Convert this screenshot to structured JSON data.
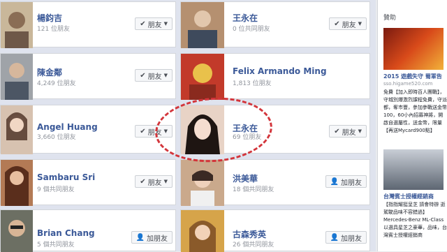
{
  "friends": [
    {
      "name": "楊鈞吉",
      "sub": "121 位朋友",
      "button": "朋友",
      "type": "friend",
      "color": "#c9b79a"
    },
    {
      "name": "王永在",
      "sub": "0 位共同朋友",
      "button": "朋友",
      "type": "friend",
      "color": "#b59070"
    },
    {
      "name": "陳金鄰",
      "sub": "4,249 位朋友",
      "button": "朋友",
      "type": "friend",
      "color": "#9fa3a8"
    },
    {
      "name": "Felix Armando Ming",
      "sub": "1,813 位朋友",
      "button": "朋友",
      "type": "friend",
      "color": "#c23a2a"
    },
    {
      "name": "Angel Huang",
      "sub": "3,660 位朋友",
      "button": "朋友",
      "type": "friend",
      "color": "#d7c2b0"
    },
    {
      "name": "王永在",
      "sub": "69 位朋友",
      "button": "朋友",
      "type": "friend",
      "color": "#e8d3c6"
    },
    {
      "name": "Sambaru Sri",
      "sub": "9 個共同朋友",
      "button": "朋友",
      "type": "friend",
      "color": "#b37a55"
    },
    {
      "name": "洪美華",
      "sub": "18 個共同朋友",
      "button": "加朋友",
      "type": "add",
      "color": "#caa98c"
    },
    {
      "name": "Brian Chang",
      "sub": "5 個共同朋友",
      "button": "加朋友",
      "type": "add",
      "color": "#6c6f63"
    },
    {
      "name": "古森秀英",
      "sub": "26 個共同朋友",
      "button": "加朋友",
      "type": "add",
      "color": "#d6a44a"
    }
  ],
  "sidebar": {
    "title": "贊助",
    "ad1_title": "2015 遊戲失守 蜀軍告",
    "ad1_url": "sso.higame520.com",
    "ad1_body": "免費【加入即時百人團戰】，守城別爆激烈課程免費，守派都，奪市豐，參加參戰送金幣100，60小內招募神將，開啟自選屬性，送金幣，限量【再送Mycard900點】",
    "ad2_title": "台灣賓士授權經銷商",
    "ad2_body": "【指指耀挺呈芝 請會特辦 逝 駕駛品味不容錯過】Mercedes-Benz ML-Class 以選具星芝之豪華，品味，台灣賓士授權經銷商"
  }
}
